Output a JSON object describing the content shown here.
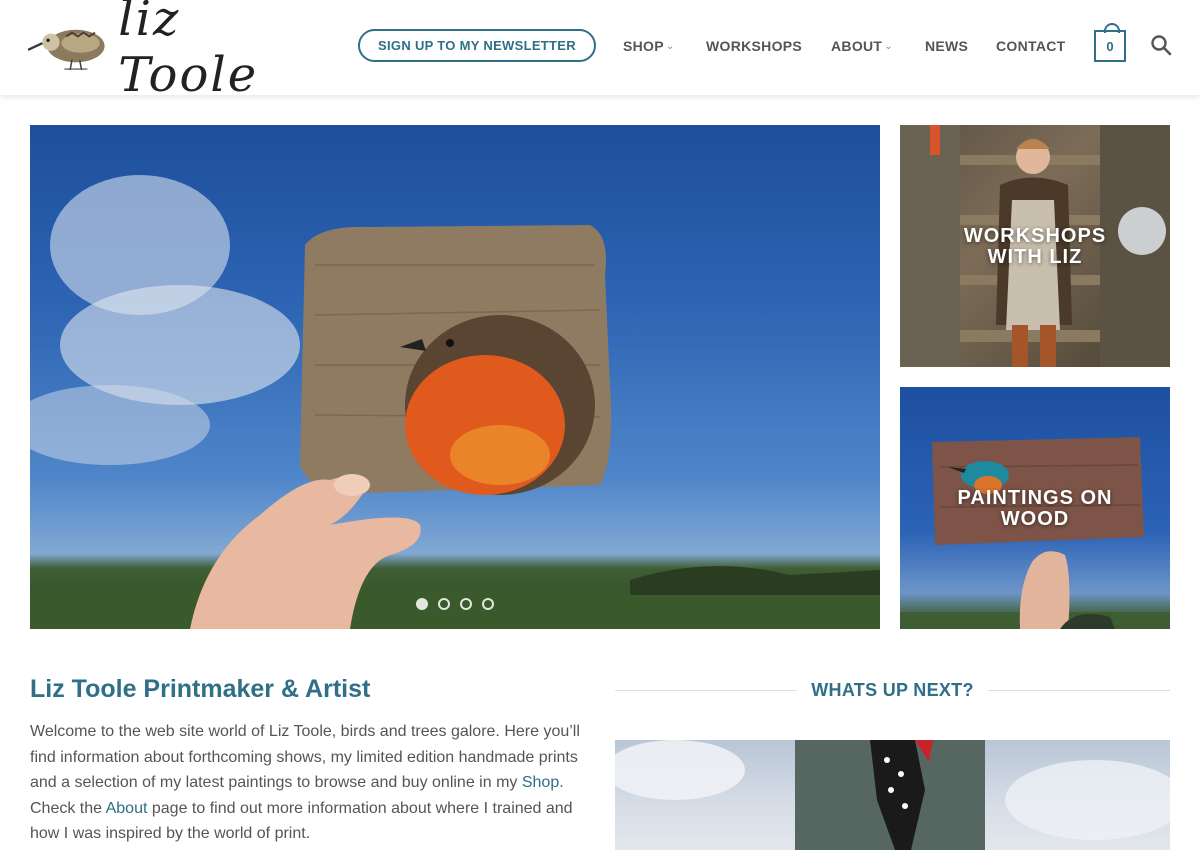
{
  "brand": {
    "name": "liz Toole"
  },
  "header": {
    "newsletter_label": "SIGN UP TO MY NEWSLETTER",
    "nav": [
      {
        "label": "SHOP",
        "has_dropdown": true
      },
      {
        "label": "WORKSHOPS",
        "has_dropdown": false
      },
      {
        "label": "ABOUT",
        "has_dropdown": true
      },
      {
        "label": "NEWS",
        "has_dropdown": false
      },
      {
        "label": "CONTACT",
        "has_dropdown": false
      }
    ],
    "cart_count": "0",
    "search_icon": "search-icon"
  },
  "hero": {
    "slide_count": 4,
    "active_slide": 1
  },
  "tiles": [
    {
      "label_line1": "WORKSHOPS",
      "label_line2": "WITH LIZ"
    },
    {
      "label_line1": "PAINTINGS ON",
      "label_line2": "WOOD"
    }
  ],
  "intro": {
    "title": "Liz Toole Printmaker & Artist",
    "text_1": "Welcome to the web site world of Liz Toole, birds and trees galore. Here you’ll find information about forthcoming shows, my limited edition handmade prints and a selection of my latest paintings to browse and buy online in my ",
    "shop_link": "Shop",
    "text_2": ". Check the ",
    "about_link": "About",
    "text_3": " page to find out more information about where I trained and how I was inspired by the world of print."
  },
  "next": {
    "heading": "WHATS UP NEXT?"
  },
  "colors": {
    "accent": "#2f6f88",
    "text": "#555555"
  }
}
